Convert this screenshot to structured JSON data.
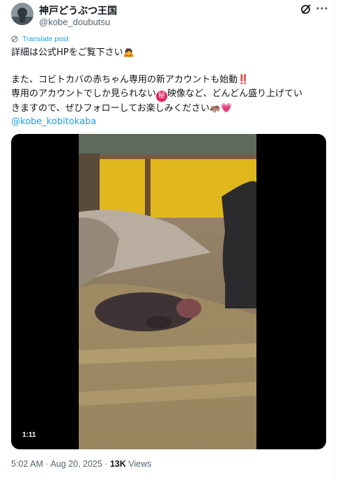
{
  "author": {
    "display_name": "神戸どうぶつ王国",
    "handle": "@kobe_doubutsu"
  },
  "post": {
    "translate_label": "Translate post",
    "line1": "詳細は公式HPをご覧下さい🙇",
    "line2": "また、コビトカバの赤ちゃん専用の新アカウントも始動‼️",
    "line3a": "専用のアカウントでしか見られない",
    "line3_secret": "秘",
    "line3b": "映像など、どんどん盛り上げてい",
    "line4": "きますので、ぜひフォローしてお楽しみください🦛💗",
    "mention": "@kobe_kobitokaba"
  },
  "video": {
    "duration": "1:11"
  },
  "meta": {
    "time": "5:02 AM",
    "separator": "·",
    "date": "Aug 20, 2025",
    "separator2": "·",
    "views_count": "13K",
    "views_label": "Views"
  },
  "icons": [
    "grok-icon",
    "more-icon",
    "translate-icon"
  ],
  "colors": {
    "link": "#1d9bf0",
    "muted": "#536471",
    "text": "#0f1419"
  }
}
